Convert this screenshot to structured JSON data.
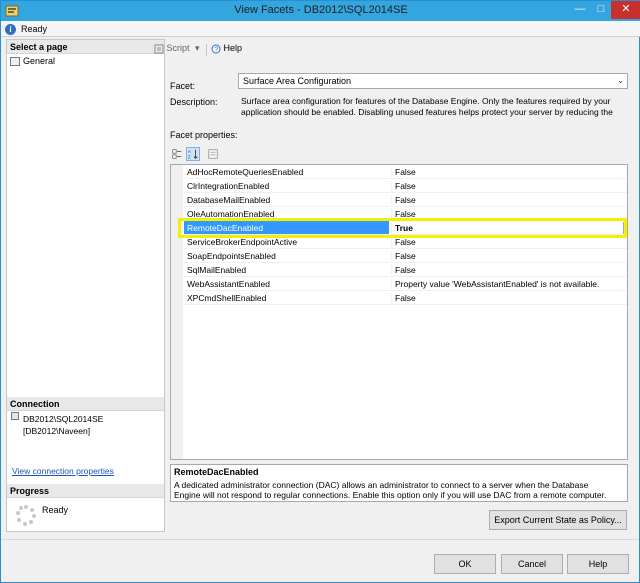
{
  "window": {
    "title": "View Facets - DB2012\\SQL2014SE",
    "status": "Ready"
  },
  "left_panel": {
    "select_page_header": "Select a page",
    "pages": [
      "General"
    ],
    "connection_header": "Connection",
    "connection_server": "DB2012\\SQL2014SE",
    "connection_user": "[DB2012\\Naveen]",
    "view_connection_link": "View connection properties",
    "progress_header": "Progress",
    "progress_status": "Ready"
  },
  "toolbar": {
    "script_label": "Script",
    "help_label": "Help"
  },
  "facet": {
    "label": "Facet:",
    "selected": "Surface Area Configuration",
    "description_label": "Description:",
    "description_line1": "Surface area configuration for features of the Database Engine. Only the features required by your",
    "description_line2": "application should be enabled. Disabling unused features helps protect your server by reducing the",
    "properties_label": "Facet properties:"
  },
  "properties": [
    {
      "name": "AdHocRemoteQueriesEnabled",
      "value": "False"
    },
    {
      "name": "ClrIntegrationEnabled",
      "value": "False"
    },
    {
      "name": "DatabaseMailEnabled",
      "value": "False"
    },
    {
      "name": "OleAutomationEnabled",
      "value": "False"
    },
    {
      "name": "RemoteDacEnabled",
      "value": "True"
    },
    {
      "name": "ServiceBrokerEndpointActive",
      "value": "False"
    },
    {
      "name": "SoapEndpointsEnabled",
      "value": "False"
    },
    {
      "name": "SqlMailEnabled",
      "value": "False"
    },
    {
      "name": "WebAssistantEnabled",
      "value": "Property value 'WebAssistantEnabled' is not available."
    },
    {
      "name": "XPCmdShellEnabled",
      "value": "False"
    }
  ],
  "help": {
    "title": "RemoteDacEnabled",
    "line1": "A dedicated administrator connection (DAC) allows an administrator to connect to a server when the Database",
    "line2": "Engine will not respond to regular connections. Enable this option only if you will use DAC from a remote computer."
  },
  "buttons": {
    "export": "Export Current State as Policy...",
    "ok": "OK",
    "cancel": "Cancel",
    "help": "Help"
  },
  "colors": {
    "titlebar": "#33a6e0",
    "selection": "#3399ff",
    "highlight_box": "#f4f000"
  }
}
